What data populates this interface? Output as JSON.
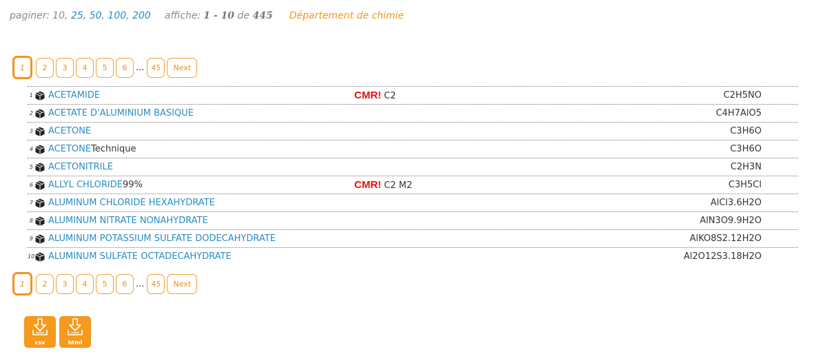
{
  "topbar": {
    "paginate_label": "paginer:",
    "sizes": [
      "10",
      "25",
      "50",
      "100",
      "200"
    ],
    "display_label": "affiche:",
    "range": "1 - 10",
    "of_label": "de",
    "total": "445",
    "department": "Département de chimie"
  },
  "pager": {
    "current": "1",
    "pages": [
      "2",
      "3",
      "4",
      "5",
      "6"
    ],
    "ellipsis": "...",
    "last": "45",
    "next": "Next"
  },
  "rows": [
    {
      "num": "1",
      "name": "ACETAMIDE",
      "extra": "",
      "cmr": "CMR!",
      "cmr_code": "C2",
      "formula": "C2H5NO"
    },
    {
      "num": "2",
      "name": "ACETATE D'ALUMINIUM BASIQUE",
      "extra": "",
      "cmr": "",
      "cmr_code": "",
      "formula": "C4H7AlO5"
    },
    {
      "num": "3",
      "name": "ACETONE",
      "extra": "",
      "cmr": "",
      "cmr_code": "",
      "formula": "C3H6O"
    },
    {
      "num": "4",
      "name": "ACETONE",
      "extra": "Technique",
      "cmr": "",
      "cmr_code": "",
      "formula": "C3H6O"
    },
    {
      "num": "5",
      "name": "ACETONITRILE",
      "extra": "",
      "cmr": "",
      "cmr_code": "",
      "formula": "C2H3N"
    },
    {
      "num": "6",
      "name": "ALLYL CHLORIDE",
      "extra": "99%",
      "cmr": "CMR!",
      "cmr_code": "C2 M2",
      "formula": "C3H5Cl"
    },
    {
      "num": "7",
      "name": "ALUMINUM CHLORIDE HEXAHYDRATE",
      "extra": "",
      "cmr": "",
      "cmr_code": "",
      "formula": "AlCl3.6H2O"
    },
    {
      "num": "8",
      "name": "ALUMINUM NITRATE NONAHYDRATE",
      "extra": "",
      "cmr": "",
      "cmr_code": "",
      "formula": "AlN3O9.9H2O"
    },
    {
      "num": "9",
      "name": "ALUMINUM POTASSIUM SULFATE DODECAHYDRATE",
      "extra": "",
      "cmr": "",
      "cmr_code": "",
      "formula": "AlKO8S2.12H2O"
    },
    {
      "num": "10",
      "name": "ALUMINUM SULFATE OCTADECAHYDRATE",
      "extra": "",
      "cmr": "",
      "cmr_code": "",
      "formula": "Al2O12S3.18H2O"
    }
  ],
  "exports": {
    "csv": "csv",
    "html": "html"
  },
  "colors": {
    "link": "#2a8cc4",
    "accent": "#f59a1c",
    "cmr": "#e01010"
  },
  "icons": {
    "product": "box-icon",
    "export": "download-icon"
  }
}
